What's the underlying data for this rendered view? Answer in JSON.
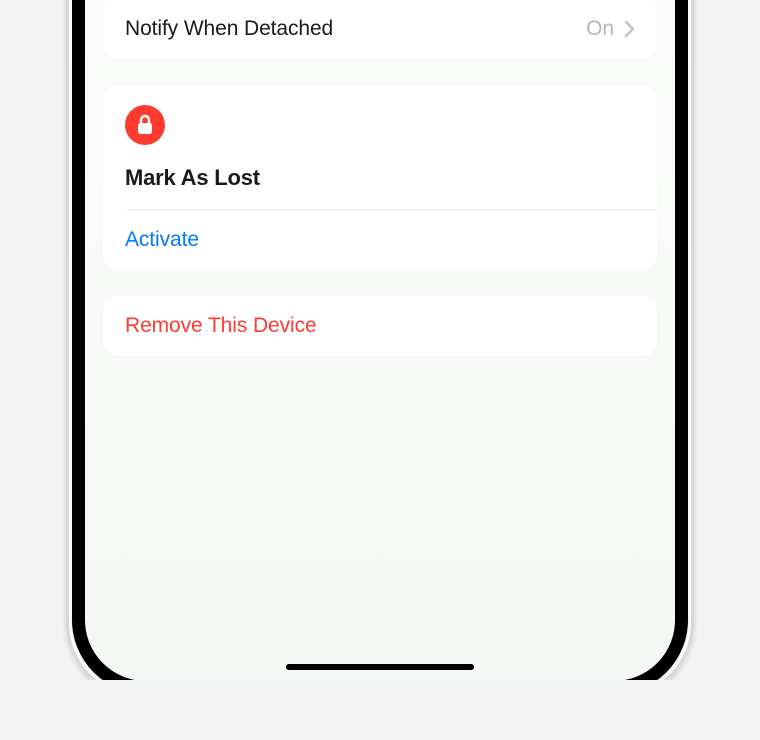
{
  "notify": {
    "label": "Notify When Detached",
    "value": "On"
  },
  "lost": {
    "title": "Mark As Lost",
    "action": "Activate"
  },
  "remove": {
    "label": "Remove This Device"
  },
  "icons": {
    "lock": "lock-icon",
    "chevron": "chevron-right-icon"
  },
  "colors": {
    "accent_blue": "#007aff",
    "destructive_red": "#ff3b30",
    "value_gray": "#b6b6bb"
  }
}
